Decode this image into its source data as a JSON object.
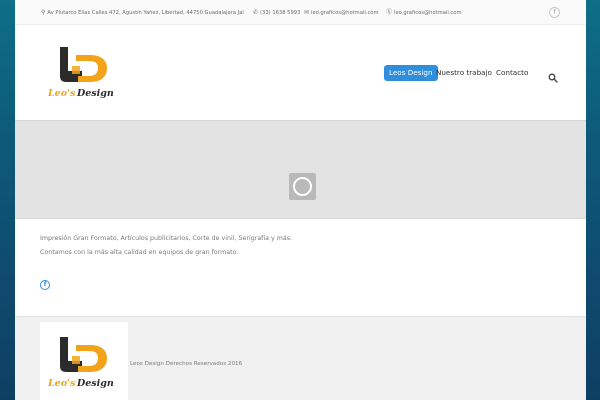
{
  "topbar": {
    "address": "Av Plutarco Elías Calles 472, Agustín Yañez, Libertad, 44750 Guadalajara Jal",
    "phone": "(33) 1638 5993",
    "email": "leo.graficos@hotmail.com",
    "skype": "leo.graficos@hotmail.com",
    "social_icon": "facebook-icon"
  },
  "header": {
    "logo_text": "Leo's Design",
    "nav": [
      {
        "label": "Leos Design",
        "active": true
      },
      {
        "label": "Nuestro trabajo",
        "active": false
      },
      {
        "label": "Contacto",
        "active": false
      }
    ],
    "search_icon": "search-icon"
  },
  "content": {
    "line1": "Impresión Gran Formato, Artículos publicitarios, Corte de vinil, Serigrafía y más.",
    "line2": "Contamos con la más alta calidad en equipos de gran formato."
  },
  "footer": {
    "logo_text": "Leo's Design",
    "copyright": "Leos Design Derechos Reservados 2016"
  },
  "colors": {
    "accent": "#2f8fdc",
    "logo_dark": "#2b2b2b",
    "logo_orange": "#f2a31a",
    "background": "#0e5a78"
  }
}
